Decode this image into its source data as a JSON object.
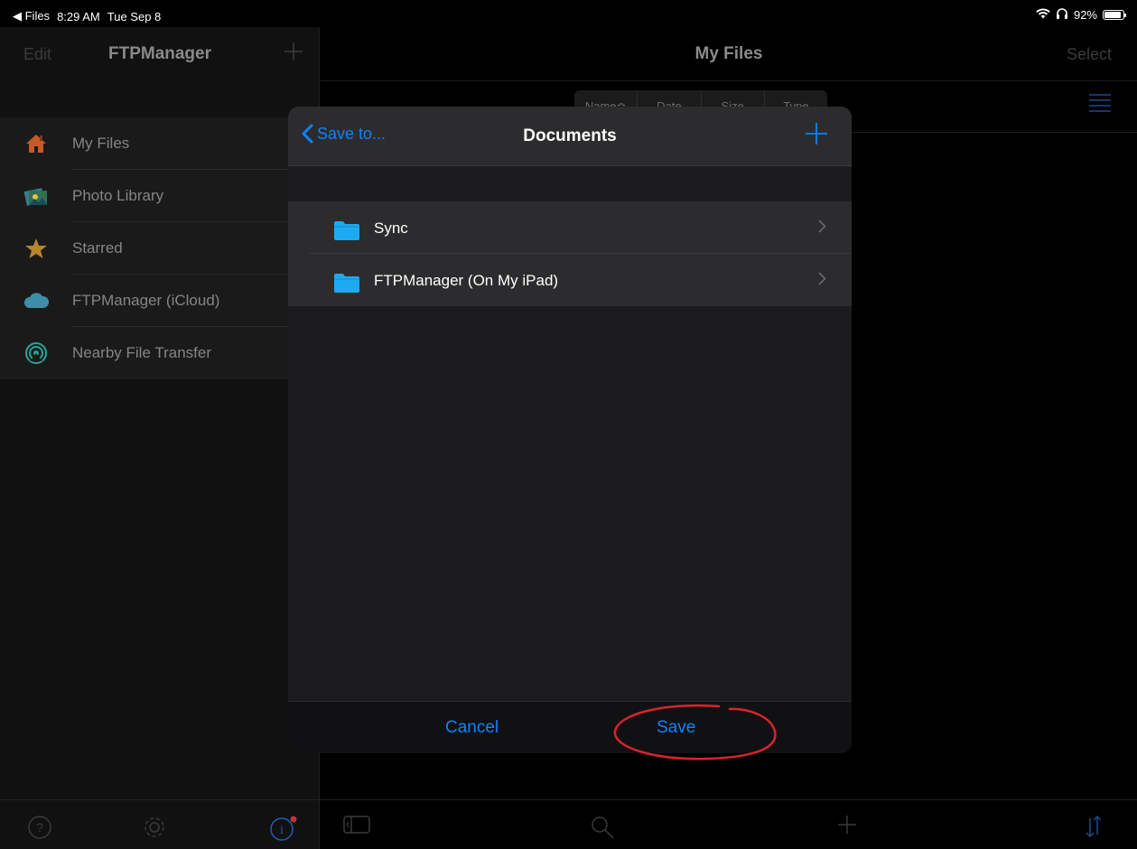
{
  "status_bar": {
    "back_app": "◀ Files",
    "time": "8:29 AM",
    "date": "Tue Sep 8",
    "battery": "92%",
    "battery_level": 0.92
  },
  "sidebar": {
    "edit_label": "Edit",
    "title": "FTPManager",
    "items": [
      {
        "label": "My Files",
        "icon": "home-icon"
      },
      {
        "label": "Photo Library",
        "icon": "photo-library-icon"
      },
      {
        "label": "Starred",
        "icon": "star-icon"
      },
      {
        "label": "FTPManager (iCloud)",
        "icon": "cloud-icon"
      },
      {
        "label": "Nearby File Transfer",
        "icon": "airdrop-icon"
      }
    ]
  },
  "main": {
    "title": "My Files",
    "select_label": "Select",
    "sort_columns": [
      "Name≎",
      "Date",
      "Size",
      "Type"
    ]
  },
  "dialog": {
    "back_label": "Save to...",
    "title": "Documents",
    "folders": [
      {
        "name": "Sync"
      },
      {
        "name": "FTPManager (On My iPad)"
      }
    ],
    "cancel_label": "Cancel",
    "save_label": "Save"
  },
  "colors": {
    "accent": "#0a84ff",
    "annotation": "#d9232e",
    "folder": "#1eaaf1"
  }
}
